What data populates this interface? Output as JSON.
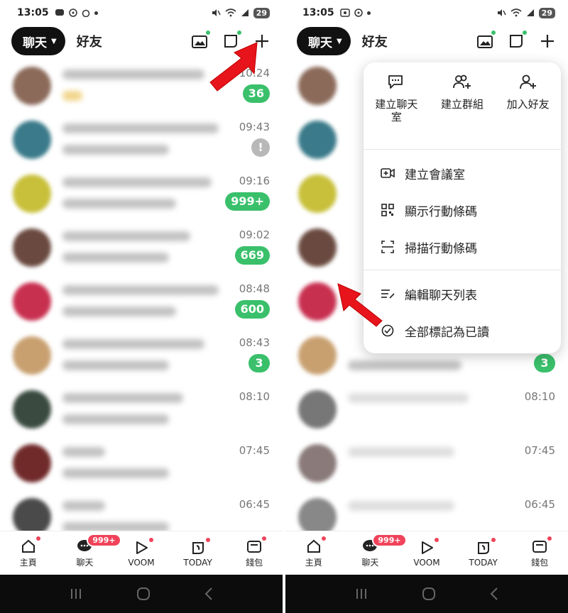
{
  "status_bar": {
    "left_time": "13:05",
    "right_time": "13:05",
    "battery": "29"
  },
  "header": {
    "chat_tab": "聊天",
    "friends_tab": "好友"
  },
  "chat_list": {
    "left_times": [
      "10:24",
      "09:43",
      "09:16",
      "09:02",
      "08:48",
      "08:43",
      "08:10",
      "07:45",
      "06:45"
    ],
    "left_badges": [
      "36",
      "!",
      "999+",
      "669",
      "600",
      "3"
    ],
    "right_badge": "3",
    "right_times": [
      "08:10",
      "07:45",
      "06:45"
    ]
  },
  "menu": {
    "top_items": [
      "建立聊天室",
      "建立群組",
      "加入好友"
    ],
    "rows": [
      "建立會議室",
      "顯示行動條碼",
      "掃描行動條碼",
      "編輯聊天列表",
      "全部標記為已讀"
    ]
  },
  "bottom_nav": {
    "home": "主頁",
    "chat": "聊天",
    "chat_badge": "999+",
    "voom": "VOOM",
    "today": "TODAY",
    "wallet": "錢包"
  },
  "colors": {
    "accent_green": "#3ac06b",
    "badge_red": "#f0435a",
    "arrow_red": "#e8141c"
  }
}
